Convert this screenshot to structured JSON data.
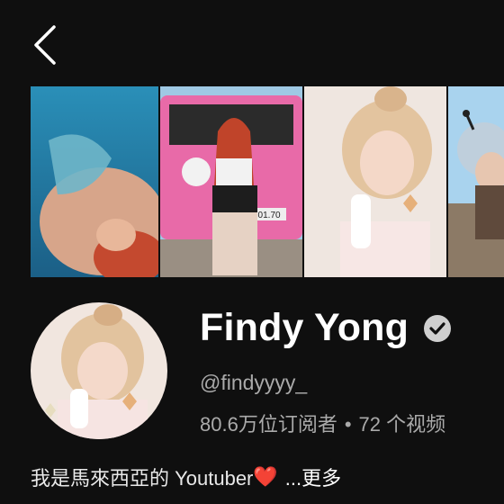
{
  "header": {
    "back_icon": "chevron-left-icon"
  },
  "banner": {
    "photos": [
      "mermaid-photo",
      "pink-jeep-photo",
      "hair-bun-photo",
      "headband-photo"
    ],
    "plate_text": "301.70"
  },
  "profile": {
    "channel_name": "Findy Yong",
    "verified_icon": "verified-check-icon",
    "handle": "@findyyyy_",
    "subscribers": "80.6万位订阅者",
    "separator": "•",
    "videos": "72 个视频",
    "description": "我是馬來西亞的 Youtuber",
    "description_emoji": "❤️",
    "more_label": "...更多"
  },
  "colors": {
    "background": "#0f0f0f",
    "secondary_text": "#aaaaaa"
  }
}
